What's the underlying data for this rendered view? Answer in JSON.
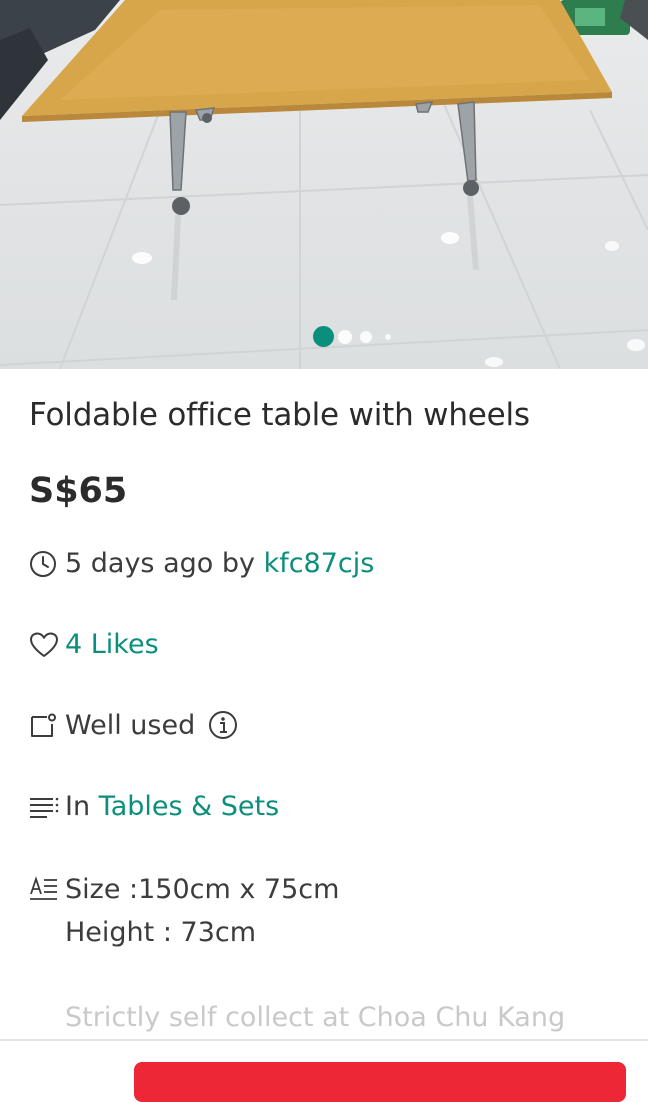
{
  "listing": {
    "title": "Foldable office table with wheels",
    "price": "S$65",
    "posted": {
      "prefix": "5 days ago by ",
      "seller": "kfc87cjs"
    },
    "likes": "4 Likes",
    "condition": "Well used",
    "category": {
      "prefix": "In ",
      "name": "Tables & Sets"
    },
    "description_lines": [
      "Size :150cm x 75cm",
      "Height : 73cm",
      "Strictly self collect at Choa Chu Kang"
    ]
  },
  "carousel": {
    "current": 1,
    "total": 4
  },
  "icons": {
    "time": "clock-icon",
    "likes": "heart-icon",
    "condition": "tag-icon",
    "condition_info": "info-icon",
    "category": "list-icon",
    "description": "text-format-icon"
  },
  "colors": {
    "accent": "#0b8f7c",
    "cta": "#ee2737",
    "text": "#3c3c3c"
  }
}
